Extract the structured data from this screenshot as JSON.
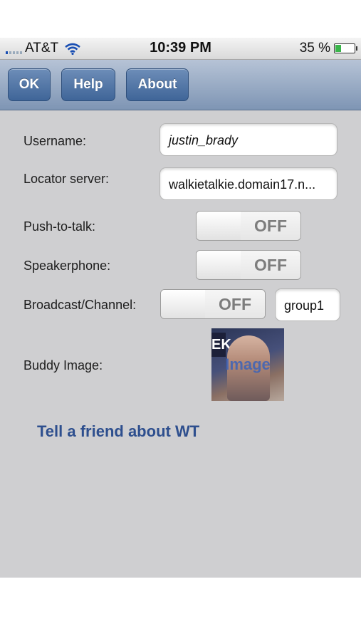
{
  "status_bar": {
    "carrier": "AT&T",
    "time": "10:39 PM",
    "battery": "35 %",
    "battery_level": 0.35
  },
  "toolbar": {
    "ok_label": "OK",
    "help_label": "Help",
    "about_label": "About"
  },
  "form": {
    "username_label": "Username:",
    "username_value": "justin_brady",
    "locator_label": "Locator server:",
    "locator_value": "walkietalkie.domain17.n...",
    "ptt_label": "Push-to-talk:",
    "ptt_state": "OFF",
    "speaker_label": "Speakerphone:",
    "speaker_state": "OFF",
    "broadcast_label": "Broadcast/Channel:",
    "broadcast_state": "OFF",
    "channel_value": "group1",
    "buddy_label": "Buddy Image:",
    "buddy_overlay": "Image",
    "buddy_logo": "EK"
  },
  "tell_friend": "Tell a friend about WT",
  "colors": {
    "toolbar": "#7e95b4",
    "button": "#3f6598",
    "link": "#2e4f8e",
    "background": "#cfcfd1"
  }
}
